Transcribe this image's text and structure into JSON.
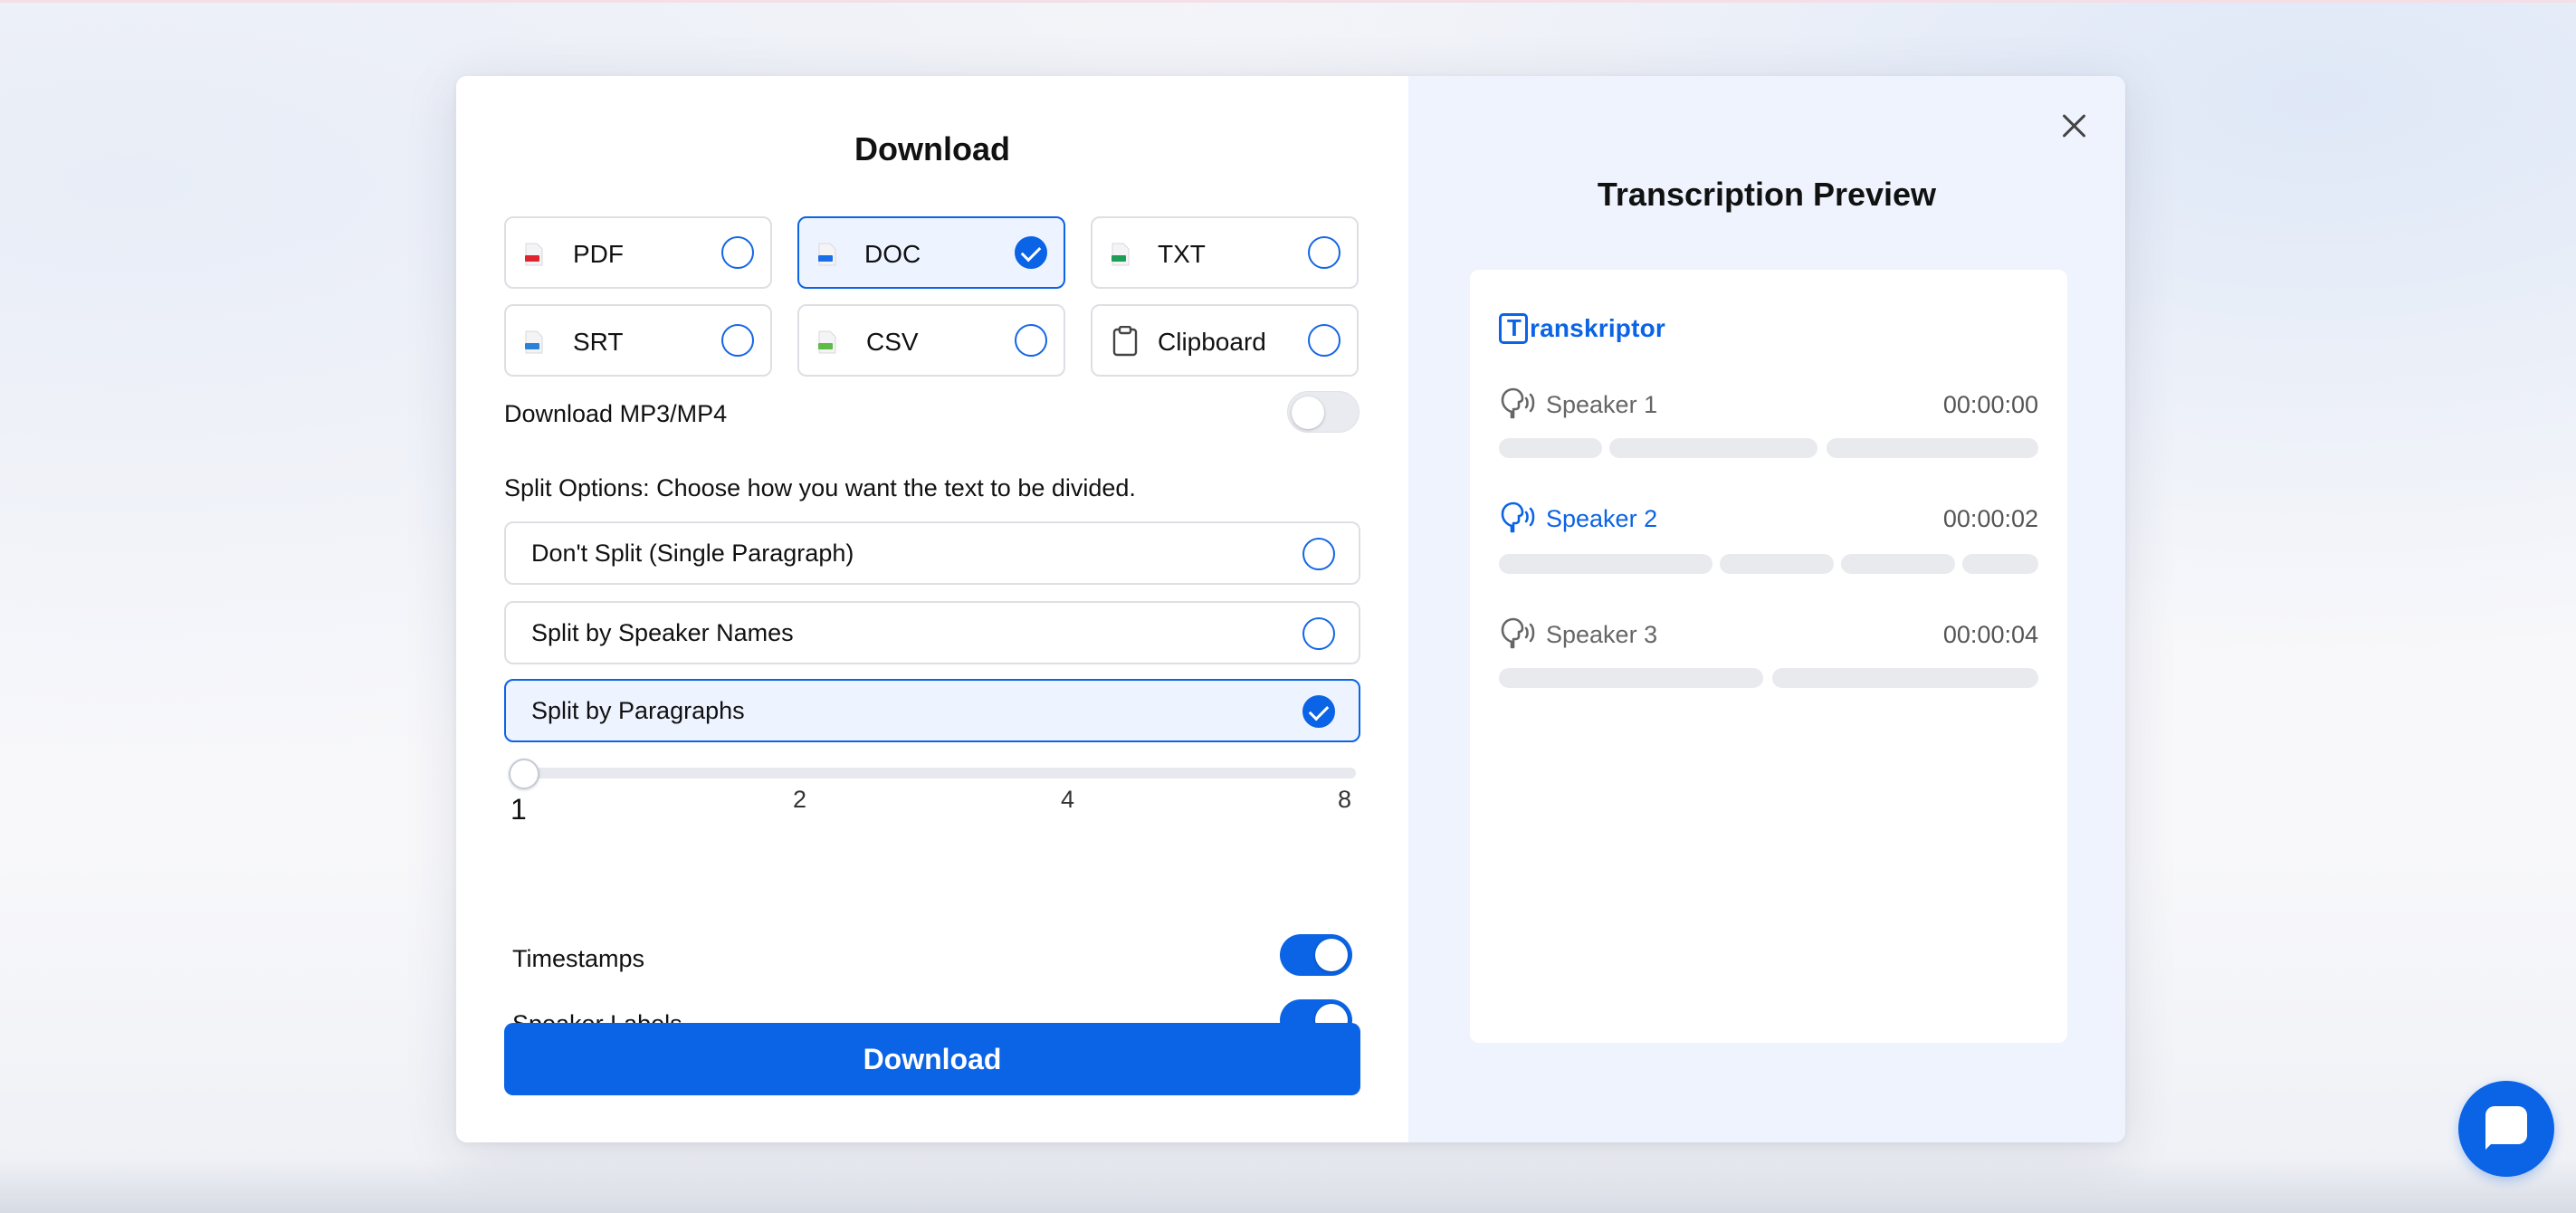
{
  "dialog": {
    "title": "Download",
    "formats": [
      {
        "id": "pdf",
        "label": "PDF",
        "selected": false,
        "icon": "pdf-file-icon",
        "color": "#e0242f"
      },
      {
        "id": "doc",
        "label": "DOC",
        "selected": true,
        "icon": "doc-file-icon",
        "color": "#1a6fe8"
      },
      {
        "id": "txt",
        "label": "TXT",
        "selected": false,
        "icon": "txt-file-icon",
        "color": "#1e9d59"
      },
      {
        "id": "srt",
        "label": "SRT",
        "selected": false,
        "icon": "srt-file-icon",
        "color": "#2a82d6"
      },
      {
        "id": "csv",
        "label": "CSV",
        "selected": false,
        "icon": "csv-file-icon",
        "color": "#5dbb46"
      },
      {
        "id": "clipboard",
        "label": "Clipboard",
        "selected": false,
        "icon": "clipboard-icon",
        "color": "#444444"
      }
    ],
    "media_toggle": {
      "label": "Download MP3/MP4",
      "on": false
    },
    "split_heading": "Split Options: Choose how you want the text to be divided.",
    "split_options": [
      {
        "label": "Don't Split (Single Paragraph)",
        "selected": false
      },
      {
        "label": "Split by Speaker Names",
        "selected": false
      },
      {
        "label": "Split by Paragraphs",
        "selected": true
      }
    ],
    "slider": {
      "ticks": [
        "1",
        "2",
        "4",
        "8"
      ],
      "value": 1
    },
    "timestamps": {
      "label": "Timestamps",
      "on": true
    },
    "speaker_labels": {
      "label": "Speaker Labels",
      "on": true
    },
    "download_label": "Download"
  },
  "preview": {
    "title": "Transcription Preview",
    "brand": "ranskriptor",
    "speakers": [
      {
        "name": "Speaker 1",
        "time": "00:00:00",
        "active": false
      },
      {
        "name": "Speaker 2",
        "time": "00:00:02",
        "active": true
      },
      {
        "name": "Speaker 3",
        "time": "00:00:04",
        "active": false
      }
    ]
  },
  "colors": {
    "accent": "#0b63e5",
    "selected_bg": "#eef4ff",
    "preview_bg": "#eef3fd"
  }
}
